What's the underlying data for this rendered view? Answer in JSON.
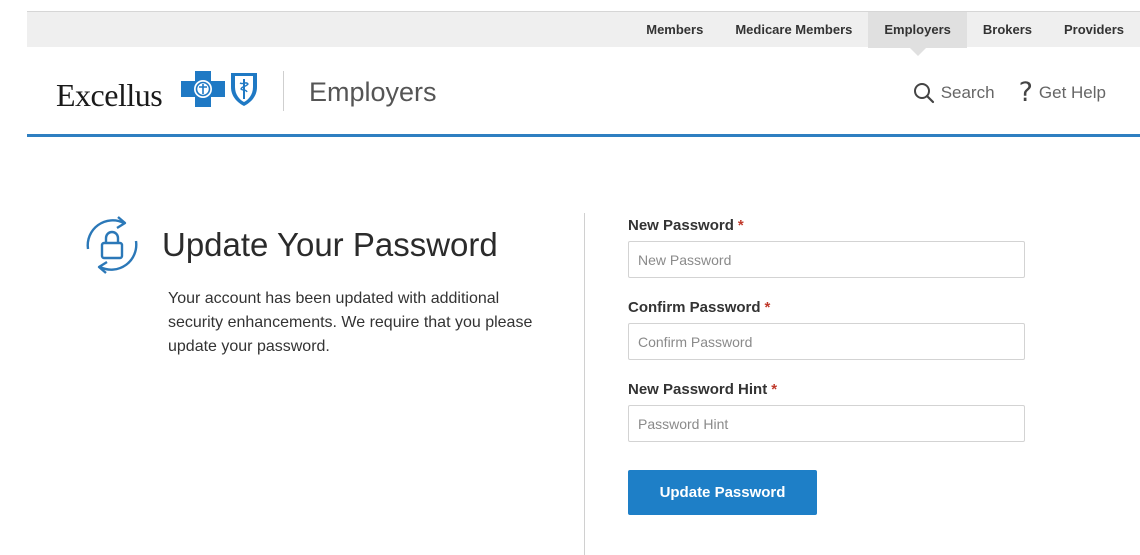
{
  "top_nav": {
    "items": [
      {
        "label": "Members",
        "active": false
      },
      {
        "label": "Medicare Members",
        "active": false
      },
      {
        "label": "Employers",
        "active": true
      },
      {
        "label": "Brokers",
        "active": false
      },
      {
        "label": "Providers",
        "active": false
      }
    ]
  },
  "header": {
    "brand": "Excellus",
    "section": "Employers",
    "search_label": "Search",
    "help_label": "Get Help",
    "help_glyph": "?"
  },
  "icons": {
    "brand_cross": "blue-cross-icon",
    "brand_shield": "blue-shield-icon",
    "search": "search-icon",
    "help": "question-mark-icon",
    "intro": "lock-refresh-icon"
  },
  "colors": {
    "accent_blue": "#1e7fc7",
    "header_rule": "#2f7fc1",
    "required_star": "#c0392b",
    "topbar_bg": "#efefef"
  },
  "intro": {
    "title": "Update Your Password",
    "text": "Your account has been updated with additional security enhancements. We require that you please update your password."
  },
  "form": {
    "new_password": {
      "label": "New Password",
      "required_mark": "*",
      "placeholder": "New Password",
      "value": ""
    },
    "confirm_password": {
      "label": "Confirm Password",
      "required_mark": "*",
      "placeholder": "Confirm Password",
      "value": ""
    },
    "hint": {
      "label": "New Password Hint",
      "required_mark": "*",
      "placeholder": "Password Hint",
      "value": ""
    },
    "submit_label": "Update Password"
  }
}
